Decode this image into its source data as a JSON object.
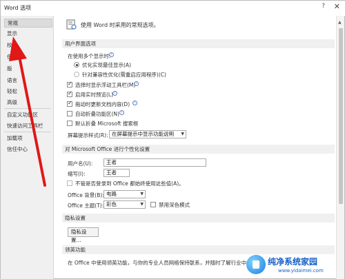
{
  "window": {
    "title": "Word 选项",
    "help": "?",
    "close": "✕"
  },
  "sidebar": {
    "items": [
      {
        "label": "常规"
      },
      {
        "label": "显示"
      },
      {
        "label": "校对"
      },
      {
        "label": "保"
      },
      {
        "label": "版"
      },
      {
        "label": "语言"
      },
      {
        "label": "轻松"
      },
      {
        "label": "高级"
      },
      {
        "label": "自定义功能区"
      },
      {
        "label": "快速访问工具栏"
      },
      {
        "label": "加载项"
      },
      {
        "label": "信任中心"
      }
    ]
  },
  "header": {
    "title": "使用 Word 时采用的常规选项。"
  },
  "ui_section": {
    "title": "用户界面选项",
    "multi_display_label": "在使用多个显示时:",
    "radio_optimize": "优化实现最佳显示(A)",
    "radio_compat": "针对兼容性优化(需重启应用程序)(C)",
    "cb_minitoolbar": "选择时显示浮动工具栏(M)",
    "cb_livepreview": "启用实时预览(L)",
    "cb_update": "拖动时更新文档内容(D)",
    "cb_collapse": "自动折叠功能区(N)",
    "cb_search": "默认折叠 Microsoft 搜索框",
    "tooltip_label": "屏幕提示样式(R):",
    "tooltip_value": "在屏幕提示中显示功能说明"
  },
  "personalize_section": {
    "title": "对 Microsoft Office 进行个性化设置",
    "username_label": "用户名(U):",
    "username_value": "王者",
    "initials_label": "缩写(I):",
    "initials_value": "王者",
    "always_use_label": "不管是否登录到 Office 都始终使用这些值(A)。",
    "background_label": "Office 背景(B):",
    "background_value": "电路",
    "theme_label": "Office 主题(T):",
    "theme_value": "彩色",
    "dark_mode_label": "禁用深色模式"
  },
  "privacy_section": {
    "title": "隐私设置",
    "button": "隐私设置..."
  },
  "linkedin_section": {
    "title": "领英功能",
    "text": "在 Office 中使用领英功能，与你的专业人员网络保持联系，并随时了解行业中的"
  },
  "watermark": {
    "brand": "纯净系统家园",
    "url": "www.yidaimei.com"
  },
  "icons": {
    "info": "info-icon",
    "settings": "settings-doc-icon"
  }
}
